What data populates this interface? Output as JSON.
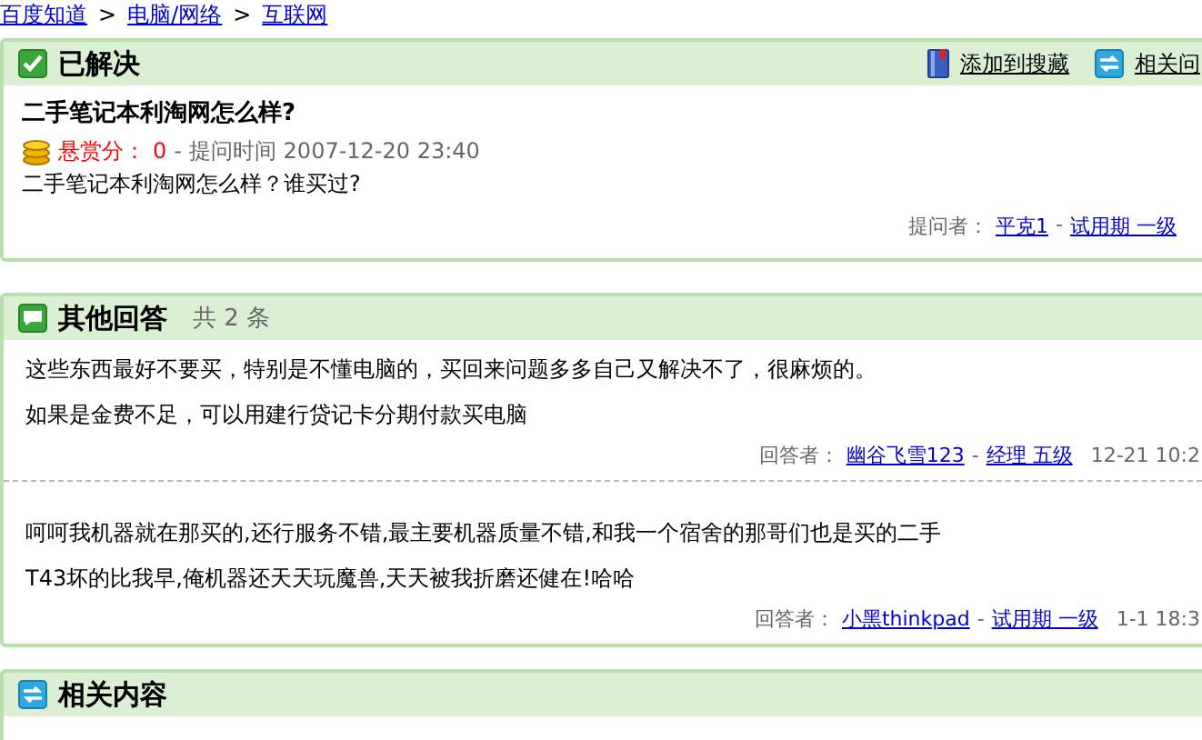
{
  "breadcrumb": [
    {
      "label": "百度知道"
    },
    {
      "label": "电脑/网络",
      "prefix": ">"
    },
    {
      "label": "互联网",
      "prefix": ">"
    }
  ],
  "question": {
    "status": "已解决",
    "actions": [
      {
        "kind": "bookmark",
        "label": "添加到搜藏"
      },
      {
        "kind": "related",
        "label": "相关问"
      }
    ],
    "title": "二手笔记本利淘网怎么样?",
    "reward_label": "悬赏分：",
    "reward": "0",
    "time_label": "- 提问时间",
    "time": "2007-12-20 23:40",
    "body": "二手笔记本利淘网怎么样？谁买过?",
    "asker_label": "提问者：",
    "asker": "平克1",
    "separator": "-",
    "rank": "试用期 一级"
  },
  "answers": {
    "title": "其他回答",
    "count": "共 2 条",
    "items": [
      {
        "lines": [
          "这些东西最好不要买，特别是不懂电脑的，买回来问题多多自己又解决不了，很麻烦的。",
          "如果是金费不足，可以用建行贷记卡分期付款买电脑"
        ],
        "label": "回答者：",
        "name": "幽谷飞雪123",
        "separator": "-",
        "rank": "经理 五级",
        "time": "12-21 10:2"
      },
      {
        "lines": [
          "呵呵我机器就在那买的,还行服务不错,最主要机器质量不错,和我一个宿舍的那哥们也是买的二手",
          "T43坏的比我早,俺机器还天天玩魔兽,天天被我折磨还健在!哈哈"
        ],
        "label": "回答者：",
        "name": "小黑thinkpad",
        "separator": "-",
        "rank": "试用期 一级",
        "time": "1-1 18:3"
      }
    ]
  },
  "related": {
    "title": "相关内容"
  }
}
